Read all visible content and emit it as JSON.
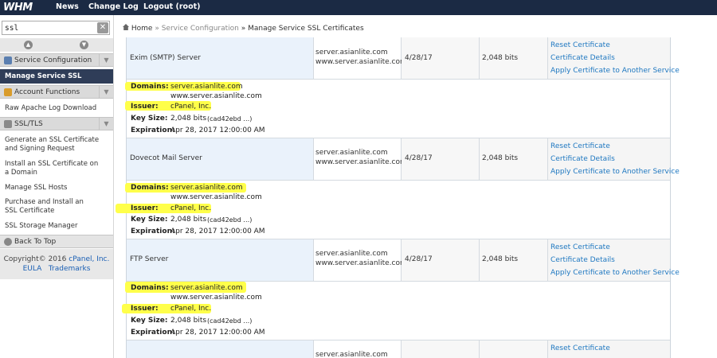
{
  "topbar": {
    "logo": "WHM",
    "nav": [
      "News",
      "Change Log",
      "Logout (root)"
    ]
  },
  "sidebar": {
    "search_value": "ssl",
    "clear_label": "✕",
    "up_arrow": "▲",
    "down_arrow": "▼",
    "categories": [
      {
        "label": "Service Configuration",
        "items": [
          "Manage Service SSL Certificates"
        ]
      },
      {
        "label": "Account Functions",
        "items": [
          "Raw Apache Log Download"
        ]
      },
      {
        "label": "SSL/TLS",
        "items": [
          "Generate an SSL Certificate and Signing Request",
          "Install an SSL Certificate on a Domain",
          "Manage SSL Hosts",
          "Purchase and Install an SSL Certificate",
          "SSL Storage Manager"
        ]
      }
    ],
    "back_to_top": "Back To Top",
    "copyright": "Copyright© 2016",
    "copyright_company": "cPanel, Inc.",
    "eula": "EULA",
    "trademarks": "Trademarks"
  },
  "breadcrumb": {
    "home": "Home",
    "sep": "»",
    "section": "Service Configuration",
    "page": "Manage Service SSL Certificates"
  },
  "services": [
    {
      "name": "Exim (SMTP) Server",
      "host1": "server.asianlite.com",
      "host2": "www.server.asianlite.com",
      "date": "4/28/17",
      "bits": "2,048 bits",
      "actions": [
        "Reset Certificate",
        "Certificate Details",
        "Apply Certificate to Another Service"
      ],
      "domains_label": "Domains:",
      "domain1": "server.asianlite.com",
      "domain2": "www.server.asianlite.com",
      "issuer_label": "Issuer:",
      "issuer": "cPanel, Inc.",
      "keysize_label": "Key Size:",
      "keysize": "2,048 bits",
      "keyid": "(cad42ebd …)",
      "expiration_label": "Expiration:",
      "expiration": "Apr 28, 2017 12:00:00 AM"
    },
    {
      "name": "Dovecot Mail Server",
      "host1": "server.asianlite.com",
      "host2": "www.server.asianlite.com",
      "date": "4/28/17",
      "bits": "2,048 bits",
      "actions": [
        "Reset Certificate",
        "Certificate Details",
        "Apply Certificate to Another Service"
      ],
      "domains_label": "Domains:",
      "domain1": "server.asianlite.com",
      "domain2": "www.server.asianlite.com",
      "issuer_label": "Issuer:",
      "issuer": "cPanel, Inc.",
      "keysize_label": "Key Size:",
      "keysize": "2,048 bits",
      "keyid": "(cad42ebd …)",
      "expiration_label": "Expiration:",
      "expiration": "Apr 28, 2017 12:00:00 AM"
    },
    {
      "name": "FTP Server",
      "host1": "server.asianlite.com",
      "host2": "www.server.asianlite.com",
      "date": "4/28/17",
      "bits": "2,048 bits",
      "actions": [
        "Reset Certificate",
        "Certificate Details",
        "Apply Certificate to Another Service"
      ],
      "domains_label": "Domains:",
      "domain1": "server.asianlite.com",
      "domain2": "www.server.asianlite.com",
      "issuer_label": "Issuer:",
      "issuer": "cPanel, Inc.",
      "keysize_label": "Key Size:",
      "keysize": "2,048 bits",
      "keyid": "(cad42ebd …)",
      "expiration_label": "Expiration:",
      "expiration": "Apr 28, 2017 12:00:00 AM"
    },
    {
      "host1": "server.asianlite.com",
      "action": "Reset Certificate"
    }
  ],
  "colors": {
    "topbar": "#1b2a44",
    "active_nav": "#2f3d58",
    "link": "#1f78c1",
    "highlight": "#ffff4a"
  }
}
